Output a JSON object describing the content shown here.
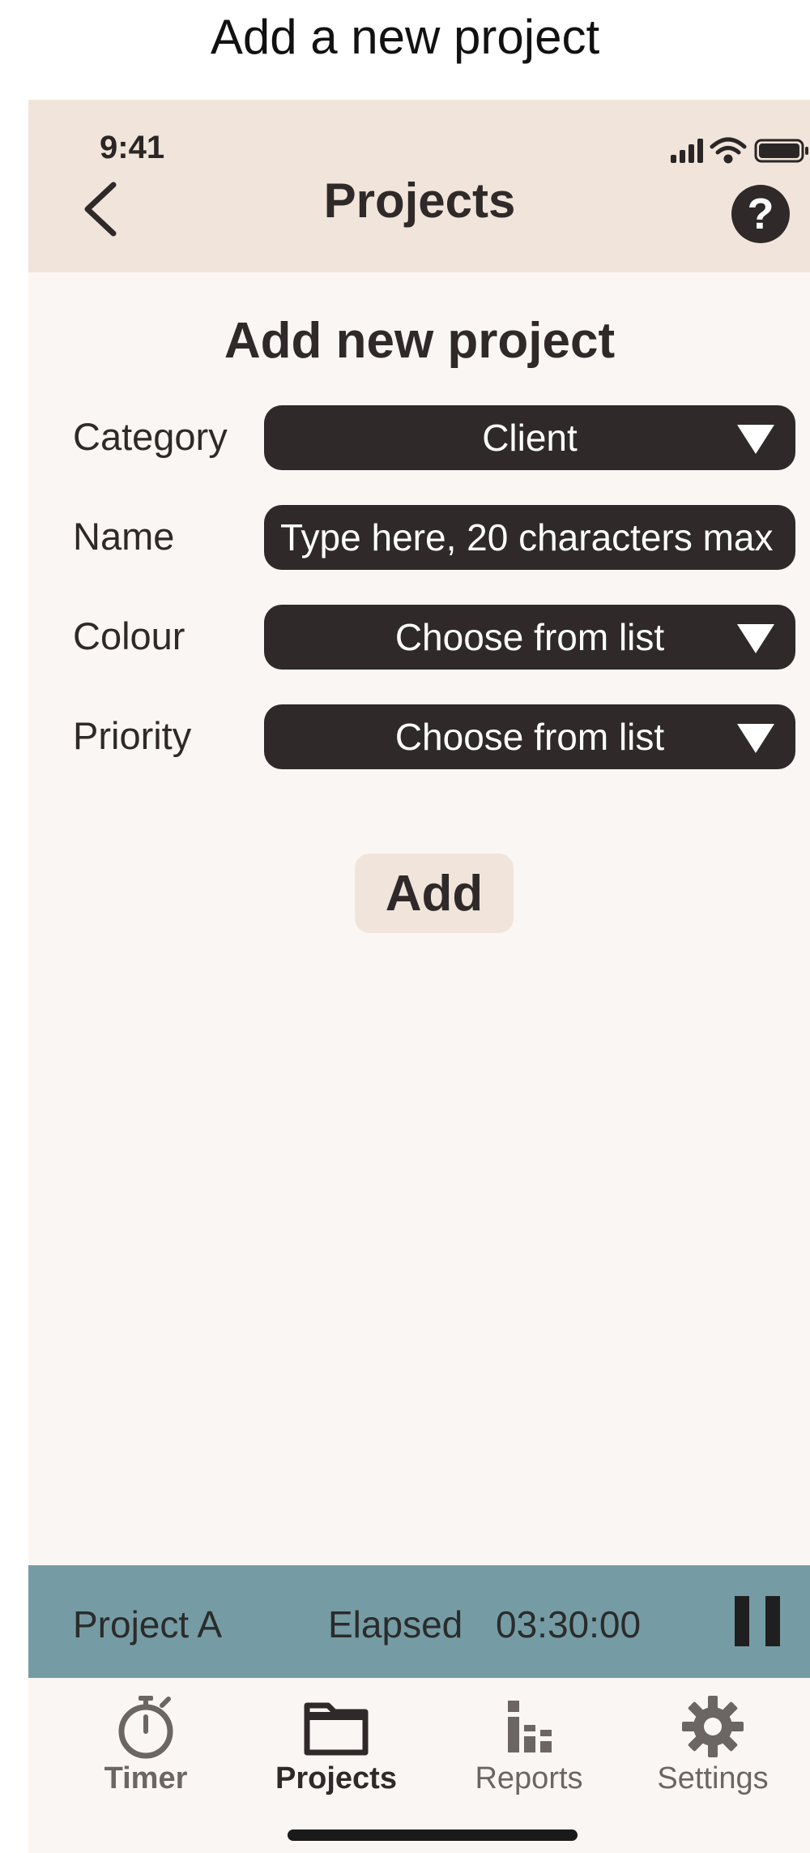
{
  "caption": "Add a new project",
  "status_bar": {
    "time": "9:41"
  },
  "header": {
    "title": "Projects",
    "help_label": "?"
  },
  "form": {
    "title": "Add new project",
    "category": {
      "label": "Category",
      "value": "Client"
    },
    "name": {
      "label": "Name",
      "placeholder": "Type here, 20 characters max"
    },
    "colour": {
      "label": "Colour",
      "value": "Choose from list"
    },
    "priority": {
      "label": "Priority",
      "value": "Choose from list"
    },
    "add_label": "Add"
  },
  "tracker": {
    "project": "Project A",
    "elapsed_label": "Elapsed",
    "elapsed_time": "03:30:00"
  },
  "tabs": [
    {
      "label": "Timer",
      "icon": "stopwatch-icon",
      "active": false
    },
    {
      "label": "Projects",
      "icon": "folder-icon",
      "active": true
    },
    {
      "label": "Reports",
      "icon": "bar-chart-icon",
      "active": false
    },
    {
      "label": "Settings",
      "icon": "gear-icon",
      "active": false
    }
  ],
  "colors": {
    "header_bg": "#f1e5db",
    "page_bg": "#faf6f3",
    "field_bg": "#2f2a29",
    "tracker_bg": "#759ca4",
    "tab_active": "#2f2a29",
    "tab_inactive": "#6b6563"
  }
}
